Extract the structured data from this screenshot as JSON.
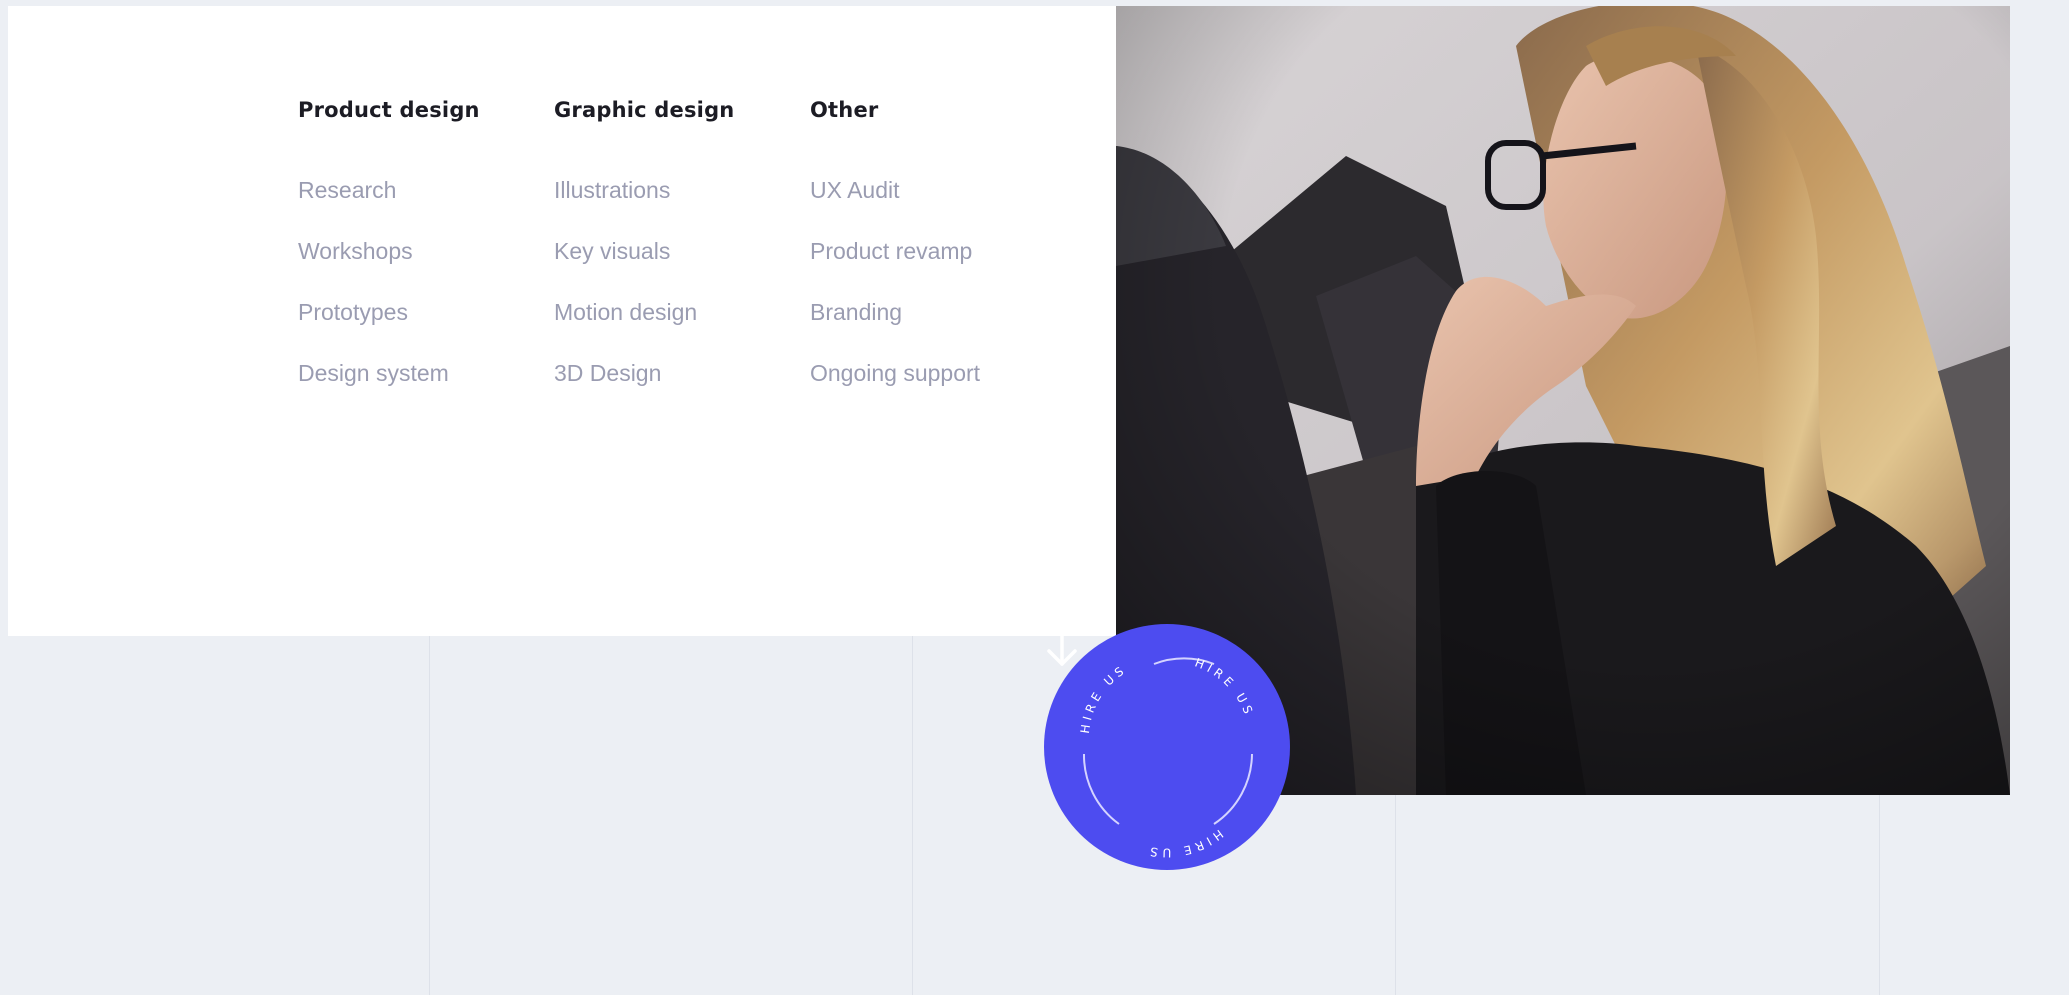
{
  "services": {
    "columns": [
      {
        "title": "Product design",
        "items": [
          "Research",
          "Workshops",
          "Prototypes",
          "Design system"
        ]
      },
      {
        "title": "Graphic design",
        "items": [
          "Illustrations",
          "Key visuals",
          "Motion design",
          "3D Design"
        ]
      },
      {
        "title": "Other",
        "items": [
          "UX Audit",
          "Product revamp",
          "Branding",
          "Ongoing support"
        ]
      }
    ]
  },
  "hire_badge": {
    "text_top_left": "HIRE US",
    "text_top_right": "HIRE US",
    "text_bottom": "HIRE US",
    "icon": "arrow-down-icon",
    "color": "#4d4cf0"
  },
  "photo": {
    "subject": "woman-with-glasses-photo"
  },
  "colors": {
    "background": "#eceff4",
    "panel": "#ffffff",
    "heading": "#1c1c24",
    "item": "#9a9cb1",
    "accent": "#4d4cf0"
  }
}
